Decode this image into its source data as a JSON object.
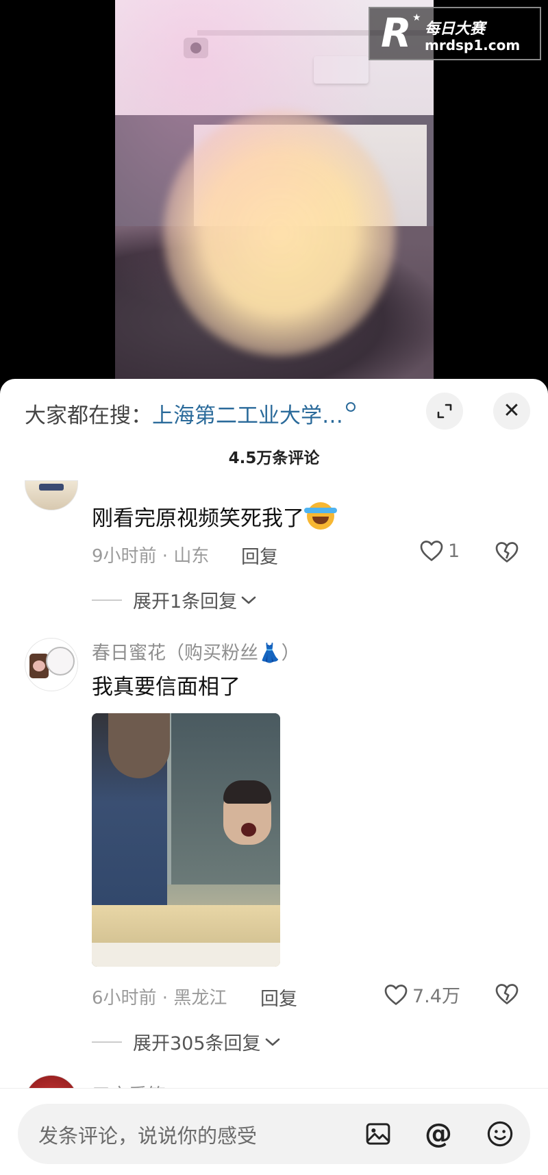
{
  "watermark": {
    "logo_letter": "R",
    "title": "每日大赛",
    "domain": "mrdsp1.com"
  },
  "sheet": {
    "search": {
      "prefix": "大家都在搜：",
      "term": "上海第二工业大学…"
    },
    "comment_count": "4.5万条评论"
  },
  "comments": [
    {
      "text": "刚看完原视频笑死我了",
      "emoji": "laughing-crying-emoji",
      "meta": "9小时前 · 山东",
      "reply_label": "回复",
      "likes": "1",
      "expand_label": "展开1条回复"
    },
    {
      "username": "春日蜜花（购买粉丝👗）",
      "text": "我真要信面相了",
      "meta": "6小时前 · 黑龙江",
      "reply_label": "回复",
      "likes": "7.4万",
      "expand_label": "展开305条回复"
    },
    {
      "username": "三宝爱笑"
    }
  ],
  "input": {
    "placeholder": "发条评论，说说你的感受"
  },
  "colors": {
    "search_term": "#2a6a9a",
    "background": "#ffffff",
    "meta": "#9a9a9a"
  }
}
